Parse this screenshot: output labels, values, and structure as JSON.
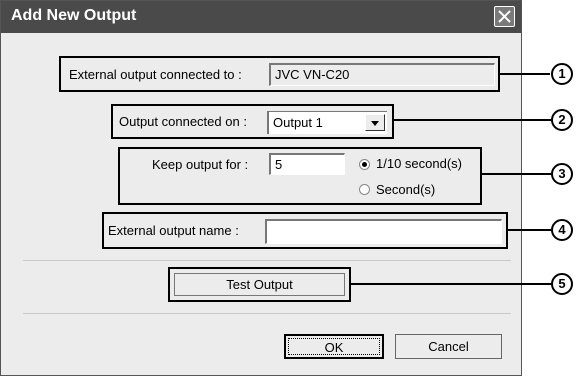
{
  "dialog": {
    "title": "Add New Output",
    "close_icon": "close-icon"
  },
  "external_output": {
    "label": "External output connected to :",
    "value": "JVC VN-C20"
  },
  "output_connected": {
    "label": "Output connected on :",
    "selected": "Output 1"
  },
  "keep_output": {
    "label": "Keep output for :",
    "value": "5",
    "options": [
      {
        "label": "1/10 second(s)",
        "selected": true
      },
      {
        "label": "Second(s)",
        "selected": false
      }
    ]
  },
  "external_output_name": {
    "label": "External output name :",
    "value": ""
  },
  "buttons": {
    "test_output": "Test Output",
    "ok": "OK",
    "cancel": "Cancel"
  },
  "callouts": [
    "1",
    "2",
    "3",
    "4",
    "5"
  ]
}
